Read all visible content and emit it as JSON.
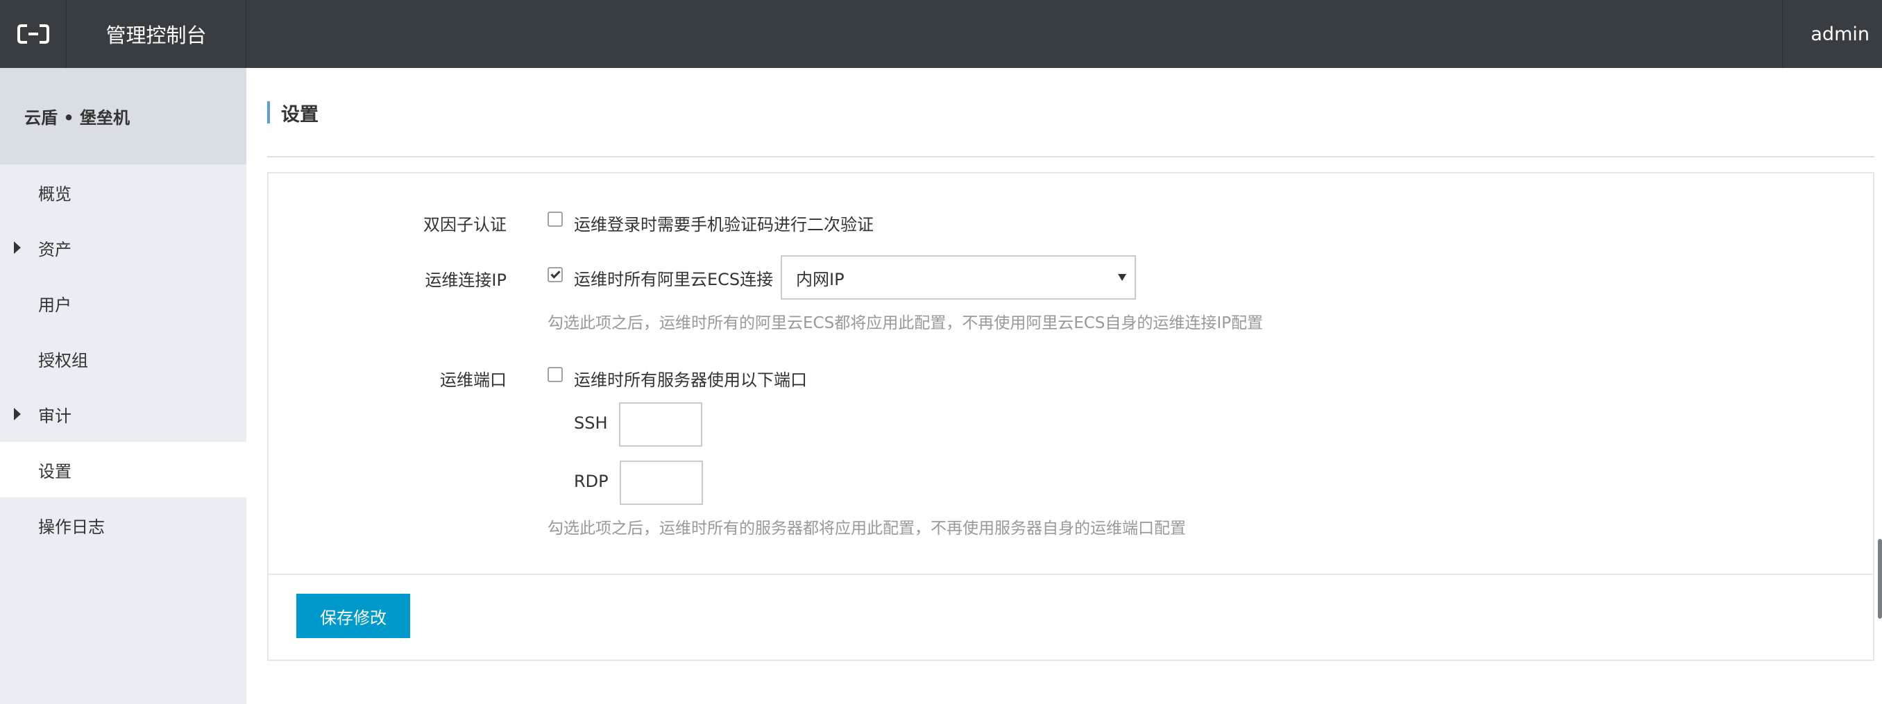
{
  "header": {
    "logo_icon": "aliyun-logo-icon",
    "console_title": "管理控制台",
    "user": "admin"
  },
  "sidebar": {
    "product_name": "云盾 • 堡垒机",
    "items": [
      {
        "label": "概览",
        "expandable": false,
        "active": false
      },
      {
        "label": "资产",
        "expandable": true,
        "active": false
      },
      {
        "label": "用户",
        "expandable": false,
        "active": false
      },
      {
        "label": "授权组",
        "expandable": false,
        "active": false
      },
      {
        "label": "审计",
        "expandable": true,
        "active": false
      },
      {
        "label": "设置",
        "expandable": false,
        "active": true
      },
      {
        "label": "操作日志",
        "expandable": false,
        "active": false
      }
    ]
  },
  "main": {
    "page_title": "设置",
    "two_factor": {
      "label": "双因子认证",
      "checkbox_label": "运维登录时需要手机验证码进行二次验证",
      "checked": false
    },
    "conn_ip": {
      "label": "运维连接IP",
      "checkbox_label": "运维时所有阿里云ECS连接",
      "checked": true,
      "select_value": "内网IP",
      "hint": "勾选此项之后，运维时所有的阿里云ECS都将应用此配置，不再使用阿里云ECS自身的运维连接IP配置"
    },
    "port": {
      "label": "运维端口",
      "checkbox_label": "运维时所有服务器使用以下端口",
      "checked": false,
      "ssh_label": "SSH",
      "ssh_value": "",
      "rdp_label": "RDP",
      "rdp_value": "",
      "hint": "勾选此项之后，运维时所有的服务器都将应用此配置，不再使用服务器自身的运维端口配置"
    },
    "save_label": "保存修改"
  },
  "colors": {
    "topbar": "#373d41",
    "sidebar": "#eaedf1",
    "sidebar_header": "#d9dee4",
    "primary_button": "#0099cc",
    "title_accent": "#5c9ed6"
  }
}
